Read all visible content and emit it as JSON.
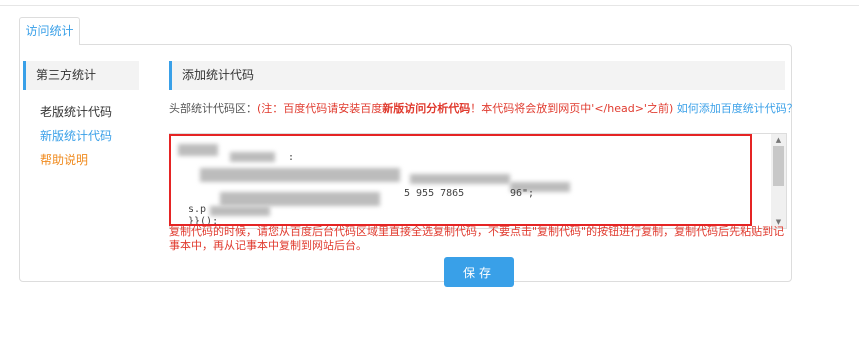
{
  "tab": {
    "label": "访问统计"
  },
  "sidebar": {
    "title": "第三方统计",
    "items": [
      {
        "label": "老版统计代码"
      },
      {
        "label": "新版统计代码"
      },
      {
        "label": "帮助说明"
      }
    ]
  },
  "main": {
    "title": "添加统计代码",
    "hint_label": "头部统计代码区：",
    "hint_red_prefix": "(注：百度代码请安装百度",
    "hint_red_bold": "新版访问分析代码",
    "hint_red_suffix": "！本代码将会放到网页中'</head>'之前)",
    "hint_link": "如何添加百度统计代码？",
    "code_fragments": [
      ":",
      "s.p",
      "5 955 7865",
      "96\";",
      "}}();"
    ],
    "note": "复制代码的时候，请您从百度后台代码区域里直接全选复制代码，不要点击\"复制代码\"的按钮进行复制，复制代码后先粘贴到记事本中，再从记事本中复制到网站后台。",
    "save_label": "保存"
  }
}
